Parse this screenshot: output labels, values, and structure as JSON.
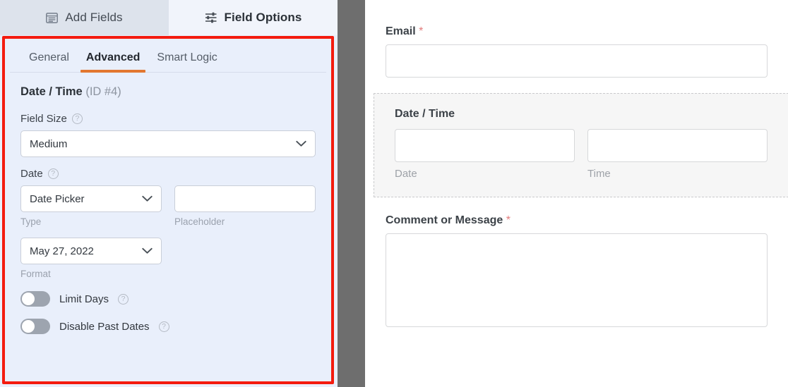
{
  "builder": {
    "top_tabs": [
      {
        "label": "Add Fields",
        "icon": "list-panel-icon",
        "active": false
      },
      {
        "label": "Field Options",
        "icon": "sliders-icon",
        "active": true
      }
    ],
    "sub_tabs": [
      {
        "label": "General",
        "active": false
      },
      {
        "label": "Advanced",
        "active": true
      },
      {
        "label": "Smart Logic",
        "active": false
      }
    ],
    "accent_color": "#e27730",
    "highlight_color": "#f41b0f",
    "panel_bg": "#e9effb"
  },
  "field_options": {
    "field_name": "Date / Time",
    "field_id": "(ID #4)",
    "field_size": {
      "label": "Field Size",
      "help": "?",
      "value": "Medium"
    },
    "date": {
      "label": "Date",
      "help": "?",
      "type_value": "Date Picker",
      "type_sublabel": "Type",
      "placeholder_value": "",
      "placeholder_text": "",
      "placeholder_sublabel": "Placeholder",
      "format_value": "May 27, 2022",
      "format_sublabel": "Format"
    },
    "toggles": [
      {
        "label": "Limit Days",
        "help": "?",
        "on": false
      },
      {
        "label": "Disable Past Dates",
        "help": "?",
        "on": false
      }
    ]
  },
  "preview": {
    "fields": [
      {
        "name": "email",
        "label": "Email",
        "required_mark": "*",
        "type": "input",
        "value": "",
        "active": false
      },
      {
        "name": "date-time",
        "label": "Date / Time",
        "required_mark": "",
        "type": "date-time",
        "active": true,
        "sub": [
          {
            "sublabel": "Date",
            "value": ""
          },
          {
            "sublabel": "Time",
            "value": ""
          }
        ]
      },
      {
        "name": "comment-or-message",
        "label": "Comment or Message",
        "required_mark": "*",
        "type": "textarea",
        "value": "",
        "active": false
      }
    ]
  }
}
